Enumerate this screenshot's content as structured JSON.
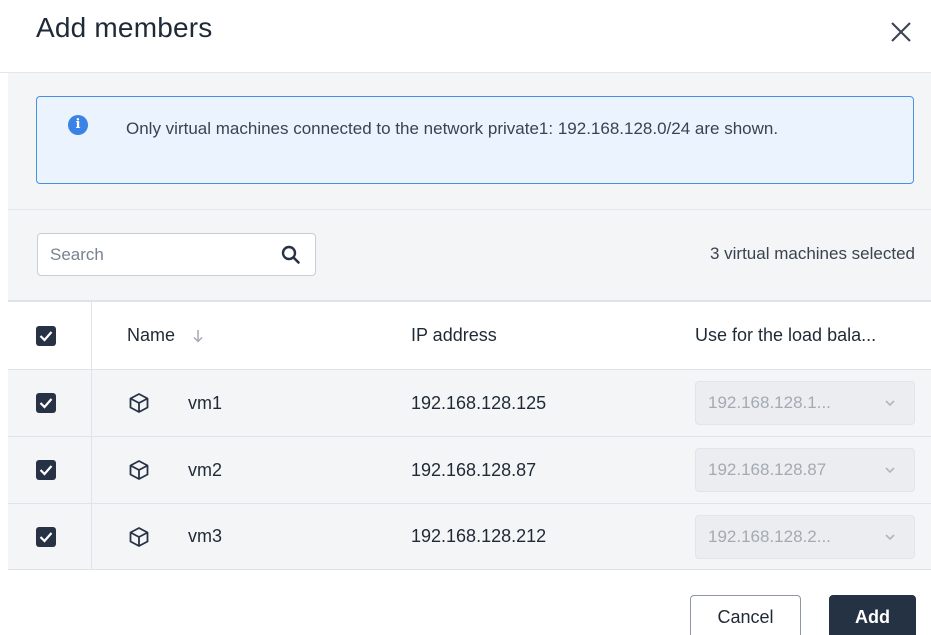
{
  "dialog": {
    "title": "Add members",
    "close_icon": "close-icon"
  },
  "info": {
    "icon": "info-icon",
    "icon_glyph": "i",
    "message": "Only virtual machines connected to the network private1: 192.168.128.0/24 are shown."
  },
  "toolbar": {
    "search_placeholder": "Search",
    "search_value": "",
    "selected_text": "3 virtual machines selected"
  },
  "table": {
    "columns": {
      "name": "Name",
      "ip": "IP address",
      "use": "Use for the load bala..."
    },
    "header_checked": true,
    "rows": [
      {
        "name": "vm1",
        "ip": "192.168.128.125",
        "use": "192.168.128.1...",
        "checked": true
      },
      {
        "name": "vm2",
        "ip": "192.168.128.87",
        "use": "192.168.128.87",
        "checked": true
      },
      {
        "name": "vm3",
        "ip": "192.168.128.212",
        "use": "192.168.128.2...",
        "checked": true
      }
    ]
  },
  "footer": {
    "cancel_label": "Cancel",
    "add_label": "Add"
  },
  "colors": {
    "accent": "#243244",
    "info_border": "#4a90e2",
    "info_bg": "#ebf3fe",
    "info_icon": "#3b82e6"
  }
}
